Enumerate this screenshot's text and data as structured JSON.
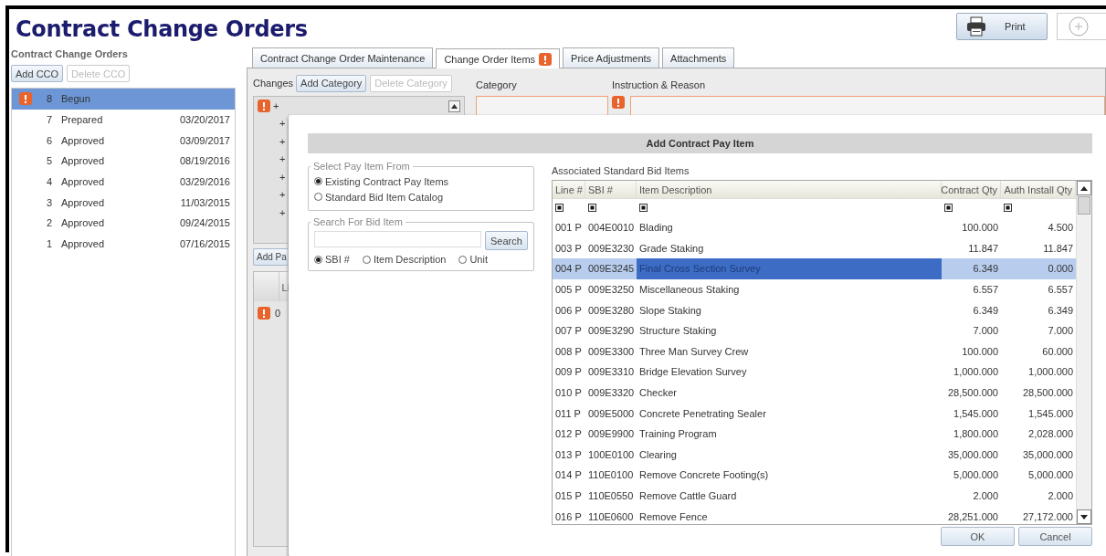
{
  "header": {
    "title": "Contract Change Orders",
    "print_button": "Print"
  },
  "sidebar": {
    "title": "Contract Change Orders",
    "buttons": [
      {
        "label": "Add CCO",
        "disabled": false
      },
      {
        "label": "Delete CCO",
        "disabled": true
      }
    ],
    "items": [
      {
        "warning": true,
        "number": "8",
        "status": "Begun",
        "selected": true
      },
      {
        "warning": false,
        "number": "7",
        "status": "Prepared",
        "date": "03/20/2017",
        "selected": false
      },
      {
        "warning": false,
        "number": "6",
        "status": "Approved",
        "date": "03/09/2017",
        "selected": false
      },
      {
        "warning": false,
        "number": "5",
        "status": "Approved",
        "date": "08/19/2016",
        "selected": false
      },
      {
        "warning": false,
        "number": "4",
        "status": "Approved",
        "date": "03/29/2016",
        "selected": false
      },
      {
        "warning": false,
        "number": "3",
        "status": "Approved",
        "date": "11/03/2015",
        "selected": false
      },
      {
        "warning": false,
        "number": "2",
        "status": "Approved",
        "date": "09/24/2015",
        "selected": false
      },
      {
        "warning": false,
        "number": "1",
        "status": "Approved",
        "date": "07/16/2015",
        "selected": false
      }
    ]
  },
  "tabs": [
    {
      "label": "Contract Change Order Maintenance",
      "selected": false,
      "warning": false
    },
    {
      "label": "Change Order Items",
      "selected": true,
      "warning": true
    },
    {
      "label": "Price Adjustments",
      "selected": false,
      "warning": false
    },
    {
      "label": "Attachments",
      "selected": false,
      "warning": false
    }
  ],
  "changes": {
    "label": "Changes",
    "buttons": [
      {
        "label": "Add Category",
        "disabled": false
      },
      {
        "label": "Delete Category",
        "disabled": true
      }
    ],
    "tree": [
      {
        "warning": true,
        "expander": "+"
      },
      {
        "warning": false,
        "expander": "+"
      },
      {
        "warning": false,
        "expander": "+"
      },
      {
        "warning": false,
        "expander": "+"
      },
      {
        "warning": false,
        "expander": "+"
      },
      {
        "warning": false,
        "expander": "+"
      },
      {
        "warning": false,
        "expander": "+"
      }
    ],
    "category": {
      "label": "Category"
    },
    "instruction": {
      "label": "Instruction & Reason",
      "warning": true
    },
    "add_button": "Add Pa",
    "items_grid": {
      "column_2": "Li",
      "rows": [
        {
          "warning": true,
          "cell": "0"
        }
      ]
    }
  },
  "dialog": {
    "title": "Add Contract Pay Item",
    "source": {
      "legend": "Select Pay Item From",
      "options": [
        {
          "label": "Existing Contract Pay Items",
          "selected": true
        },
        {
          "label": "Standard Bid Item Catalog",
          "selected": false
        }
      ]
    },
    "search": {
      "legend": "Search For Bid Item",
      "button": "Search",
      "options": [
        {
          "label": "SBI #",
          "selected": true
        },
        {
          "label": "Item Description",
          "selected": false
        },
        {
          "label": "Unit",
          "selected": false
        }
      ]
    },
    "grid": {
      "title": "Associated Standard Bid Items",
      "columns": [
        "Line #",
        "SBI #",
        "Item Description",
        "Contract Qty",
        "Auth Install Qty"
      ],
      "rows": [
        {
          "cells": [
            "001 P",
            "004E0010",
            "Blading",
            "100.000",
            "4.500"
          ],
          "selected": false
        },
        {
          "cells": [
            "003 P",
            "009E3230",
            "Grade Staking",
            "11.847",
            "11.847"
          ],
          "selected": false
        },
        {
          "cells": [
            "004 P",
            "009E3245",
            "Final Cross Section Survey",
            "6.349",
            "0.000"
          ],
          "selected": true
        },
        {
          "cells": [
            "005 P",
            "009E3250",
            "Miscellaneous Staking",
            "6.557",
            "6.557"
          ],
          "selected": false
        },
        {
          "cells": [
            "006 P",
            "009E3280",
            "Slope Staking",
            "6.349",
            "6.349"
          ],
          "selected": false
        },
        {
          "cells": [
            "007 P",
            "009E3290",
            "Structure Staking",
            "7.000",
            "7.000"
          ],
          "selected": false
        },
        {
          "cells": [
            "008 P",
            "009E3300",
            "Three Man Survey Crew",
            "100.000",
            "60.000"
          ],
          "selected": false
        },
        {
          "cells": [
            "009 P",
            "009E3310",
            "Bridge Elevation Survey",
            "1,000.000",
            "1,000.000"
          ],
          "selected": false
        },
        {
          "cells": [
            "010 P",
            "009E3320",
            "Checker",
            "28,500.000",
            "28,500.000"
          ],
          "selected": false
        },
        {
          "cells": [
            "011 P",
            "009E5000",
            "Concrete Penetrating Sealer",
            "1,545.000",
            "1,545.000"
          ],
          "selected": false
        },
        {
          "cells": [
            "012 P",
            "009E9900",
            "Training Program",
            "1,800.000",
            "2,028.000"
          ],
          "selected": false
        },
        {
          "cells": [
            "013 P",
            "100E0100",
            "Clearing",
            "35,000.000",
            "35,000.000"
          ],
          "selected": false
        },
        {
          "cells": [
            "014 P",
            "110E0100",
            "Remove Concrete Footing(s)",
            "5,000.000",
            "5,000.000"
          ],
          "selected": false
        },
        {
          "cells": [
            "015 P",
            "110E0550",
            "Remove Cattle Guard",
            "2.000",
            "2.000"
          ],
          "selected": false
        },
        {
          "cells": [
            "016 P",
            "110E0600",
            "Remove Fence",
            "28,251.000",
            "27,172.000"
          ],
          "selected": false
        }
      ]
    },
    "buttons": [
      "OK",
      "Cancel"
    ]
  }
}
